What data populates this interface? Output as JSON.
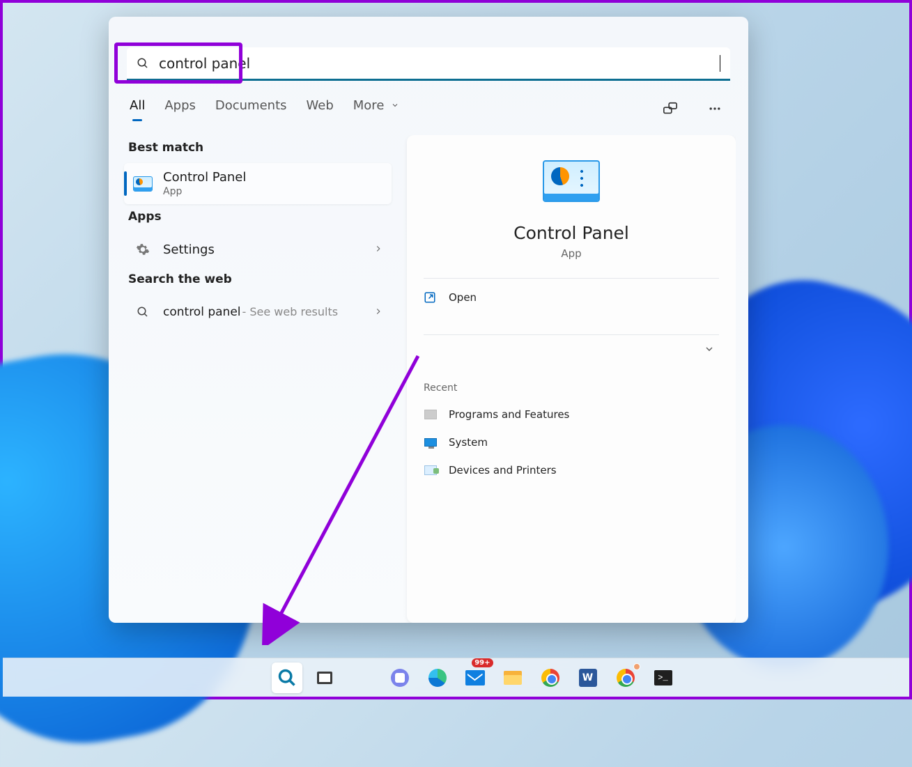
{
  "search": {
    "query": "control panel"
  },
  "tabs": {
    "all": "All",
    "apps": "Apps",
    "documents": "Documents",
    "web": "Web",
    "more": "More"
  },
  "sections": {
    "best_match": "Best match",
    "apps": "Apps",
    "search_web": "Search the web"
  },
  "best_match": {
    "title": "Control Panel",
    "subtitle": "App"
  },
  "apps_list": [
    {
      "label": "Settings"
    }
  ],
  "web": {
    "query": "control panel",
    "suffix": " - See web results"
  },
  "preview": {
    "title": "Control Panel",
    "subtitle": "App",
    "open_label": "Open",
    "recent_title": "Recent",
    "recent": [
      {
        "label": "Programs and Features"
      },
      {
        "label": "System"
      },
      {
        "label": "Devices and Printers"
      }
    ]
  },
  "taskbar": {
    "mail_badge": "99+",
    "word_letter": "W",
    "terminal_prompt": ">_"
  }
}
